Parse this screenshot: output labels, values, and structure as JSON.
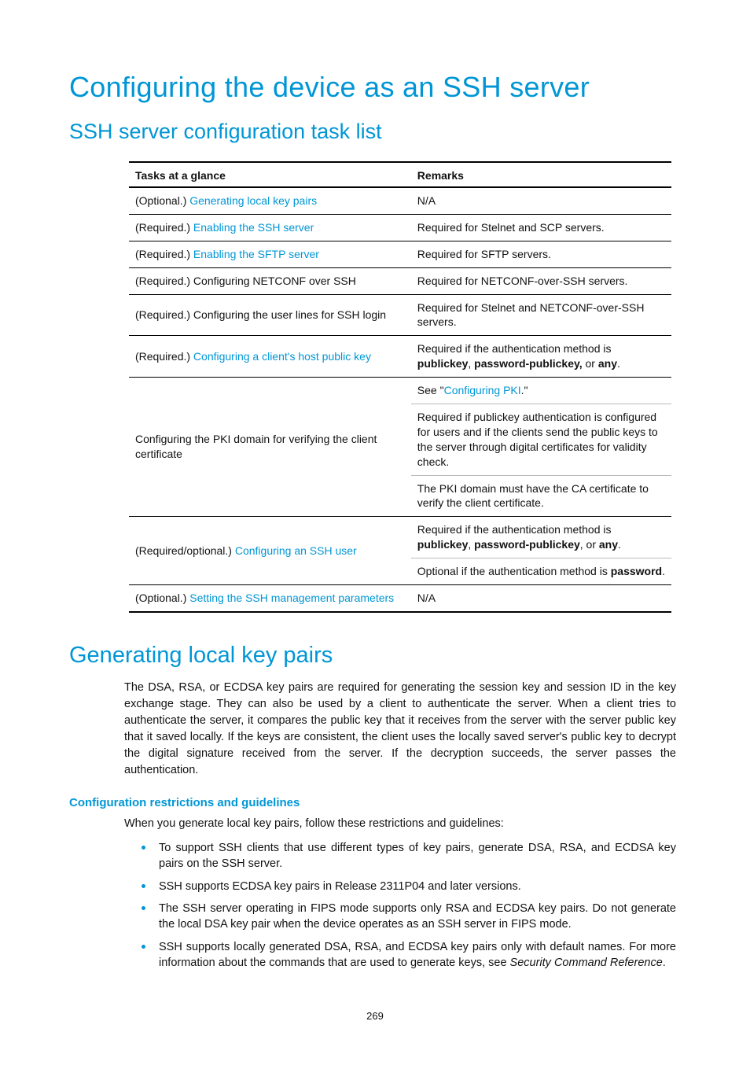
{
  "page_number": "269",
  "heading_title": "Configuring the device as an SSH server",
  "heading_tasklist": "SSH server configuration task list",
  "table": {
    "col_tasks": "Tasks at a glance",
    "col_remarks": "Remarks",
    "rows": {
      "r1": {
        "prefix": "(Optional.) ",
        "link": "Generating local key pairs",
        "remark": "N/A"
      },
      "r2": {
        "prefix": "(Required.) ",
        "link": "Enabling the SSH server",
        "remark": "Required for Stelnet and SCP servers."
      },
      "r3": {
        "prefix": "(Required.) ",
        "link": "Enabling the SFTP server",
        "remark": "Required for SFTP servers."
      },
      "r4": {
        "task_text": "(Required.) Configuring NETCONF over SSH",
        "remark": "Required for NETCONF-over-SSH servers."
      },
      "r5": {
        "task_text": "(Required.) Configuring the user lines for SSH login",
        "remark": "Required for Stelnet and NETCONF-over-SSH servers."
      },
      "r6": {
        "prefix": "(Required.) ",
        "link": "Configuring a client's host public key",
        "remark_pre": "Required if the authentication method is ",
        "bold1": "publickey",
        "mid1": ", ",
        "bold2": "password-publickey,",
        "mid2": " or ",
        "bold3": "any",
        "tail": "."
      },
      "r7": {
        "task_text": "Configuring the PKI domain for verifying the client certificate",
        "see_pre": "See \"",
        "see_link": "Configuring PKI",
        "see_post": ".\"",
        "para2": "Required if publickey authentication is configured for users and if the clients send the public keys to the server through digital certificates for validity check.",
        "para3": "The PKI domain must have the CA certificate to verify the client certificate."
      },
      "r8": {
        "prefix": "(Required/optional.) ",
        "link": "Configuring an SSH user",
        "line1_pre": "Required if the authentication method is ",
        "l1_b1": "publickey",
        "l1_m1": ", ",
        "l1_b2": "password-publickey",
        "l1_m2": ", or ",
        "l1_b3": "any",
        "l1_tail": ".",
        "line2_pre": "Optional if the authentication method is ",
        "l2_b1": "password",
        "l2_tail": "."
      },
      "r9": {
        "prefix": "(Optional.) ",
        "link": "Setting the SSH management parameters",
        "remark": "N/A"
      }
    }
  },
  "section_gen": {
    "title": "Generating local key pairs",
    "para1": "The DSA, RSA, or ECDSA key pairs are required for generating the session key and session ID in the key exchange stage. They can also be used by a client to authenticate the server. When a client tries to authenticate the server, it compares the public key that it receives from the server with the server public key that it saved locally. If the keys are consistent, the client uses the locally saved server's public key to decrypt the digital signature received from the server. If the decryption succeeds, the server passes the authentication."
  },
  "restrictions": {
    "title": "Configuration restrictions and guidelines",
    "intro": "When you generate local key pairs, follow these restrictions and guidelines:",
    "b1": "To support SSH clients that use different types of key pairs, generate DSA, RSA, and ECDSA key pairs on the SSH server.",
    "b2": "SSH supports ECDSA key pairs in Release 2311P04 and later versions.",
    "b3": "The SSH server operating in FIPS mode supports only RSA and ECDSA key pairs. Do not generate the local DSA key pair when the device operates as an SSH server in FIPS mode.",
    "b4_pre": "SSH supports locally generated DSA, RSA, and ECDSA key pairs only with default names. For more information about the commands that are used to generate keys, see ",
    "b4_ital": "Security Command Reference",
    "b4_post": "."
  }
}
